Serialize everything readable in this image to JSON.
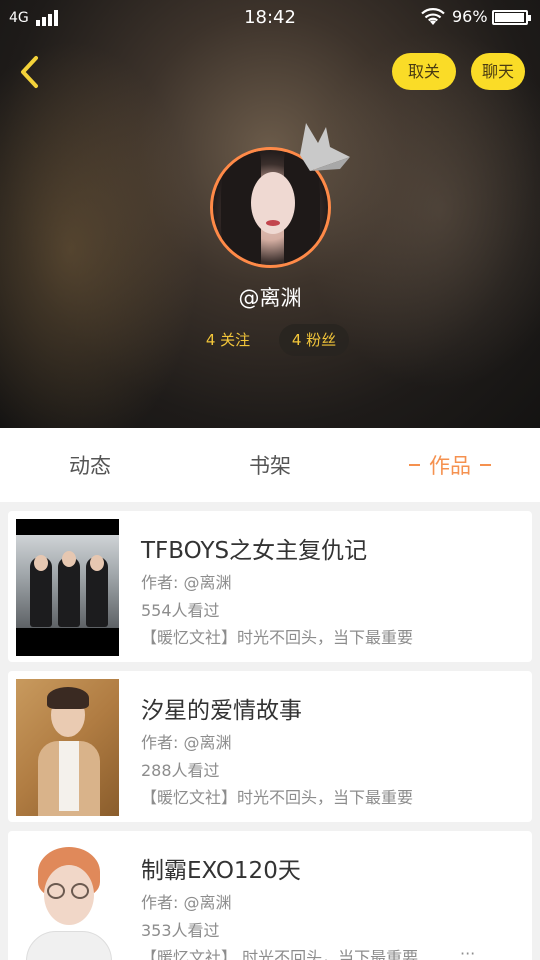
{
  "status_bar": {
    "network": "4G",
    "time": "18:42",
    "battery_percent": "96%",
    "battery_level": 0.96
  },
  "header": {
    "back_icon": "chevron-left-icon",
    "unfollow_label": "取关",
    "chat_label": "聊天",
    "username": "@离渊",
    "follow_count": "4 关注",
    "fans_count": "4 粉丝",
    "accent_color": "#fadc27",
    "avatar_border_color": "#ff8a48"
  },
  "tabs": {
    "items": [
      {
        "label": "动态",
        "active": false
      },
      {
        "label": "书架",
        "active": false
      },
      {
        "label": "作品",
        "active": true
      }
    ],
    "active_color": "#f5914f"
  },
  "works": [
    {
      "title": "TFBOYS之女主复仇记",
      "author": "作者: @离渊",
      "views": "554人看过",
      "desc": "【暖忆文社】时光不回头，当下最重要"
    },
    {
      "title": "汐星的爱情故事",
      "author": "作者: @离渊",
      "views": "288人看过",
      "desc": "【暖忆文社】时光不回头，当下最重要"
    },
    {
      "title": "制霸EXO120天",
      "author": "作者: @离渊",
      "views": "353人看过",
      "desc": "【暖忆文社】 时光不回头，当下最重要",
      "more": "···"
    }
  ]
}
